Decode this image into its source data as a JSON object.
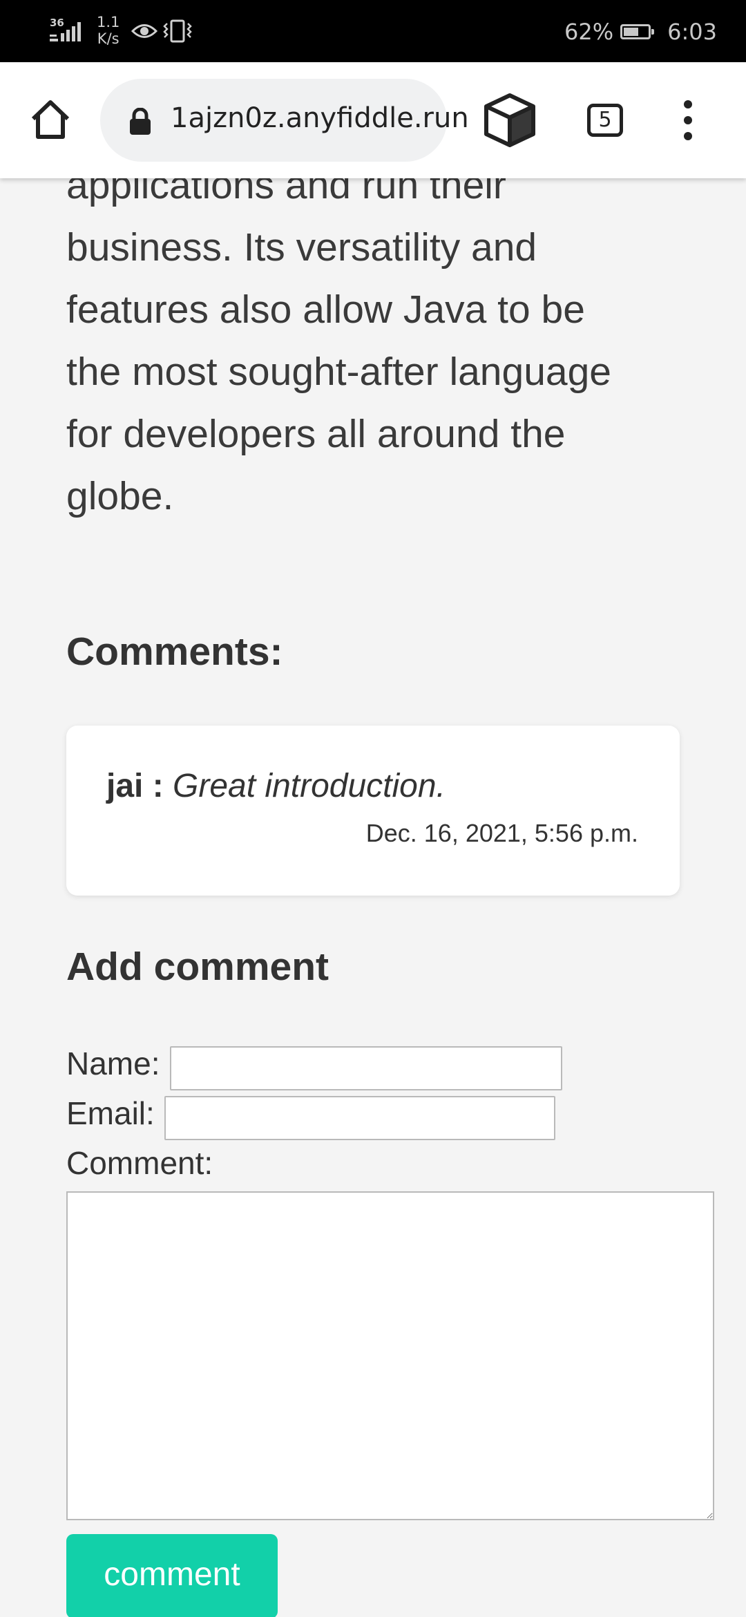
{
  "status_bar": {
    "network_type": "36",
    "speed_value": "1.1",
    "speed_unit": "K/s",
    "battery_percent": "62%",
    "battery_level": 0.62,
    "time": "6:03",
    "icons": [
      "signal-icon",
      "eye-icon",
      "vibrate-icon",
      "battery-icon"
    ]
  },
  "browser": {
    "url": "1ajzn0z.anyfiddle.run",
    "tab_count": "5",
    "icons": [
      "home-icon",
      "lock-icon",
      "cube-icon",
      "tabs-icon",
      "more-menu-icon"
    ]
  },
  "article": {
    "lines": [
      "applications and run their",
      "business. Its versatility and",
      "features also allow Java to be",
      "the most sought-after language",
      "for developers all around the",
      "globe."
    ]
  },
  "comments": {
    "heading": "Comments:",
    "items": [
      {
        "author": "jai",
        "separator": " : ",
        "text": "Great introduction.",
        "date": "Dec. 16, 2021, 5:56 p.m."
      }
    ]
  },
  "form": {
    "heading": "Add comment",
    "name_label": "Name:",
    "email_label": "Email:",
    "comment_label": "Comment:",
    "name_value": "",
    "email_value": "",
    "comment_value": "",
    "submit_label": "comment"
  },
  "colors": {
    "accent": "#12d0a9",
    "background": "#f4f4f4",
    "status_bar": "#000000"
  }
}
